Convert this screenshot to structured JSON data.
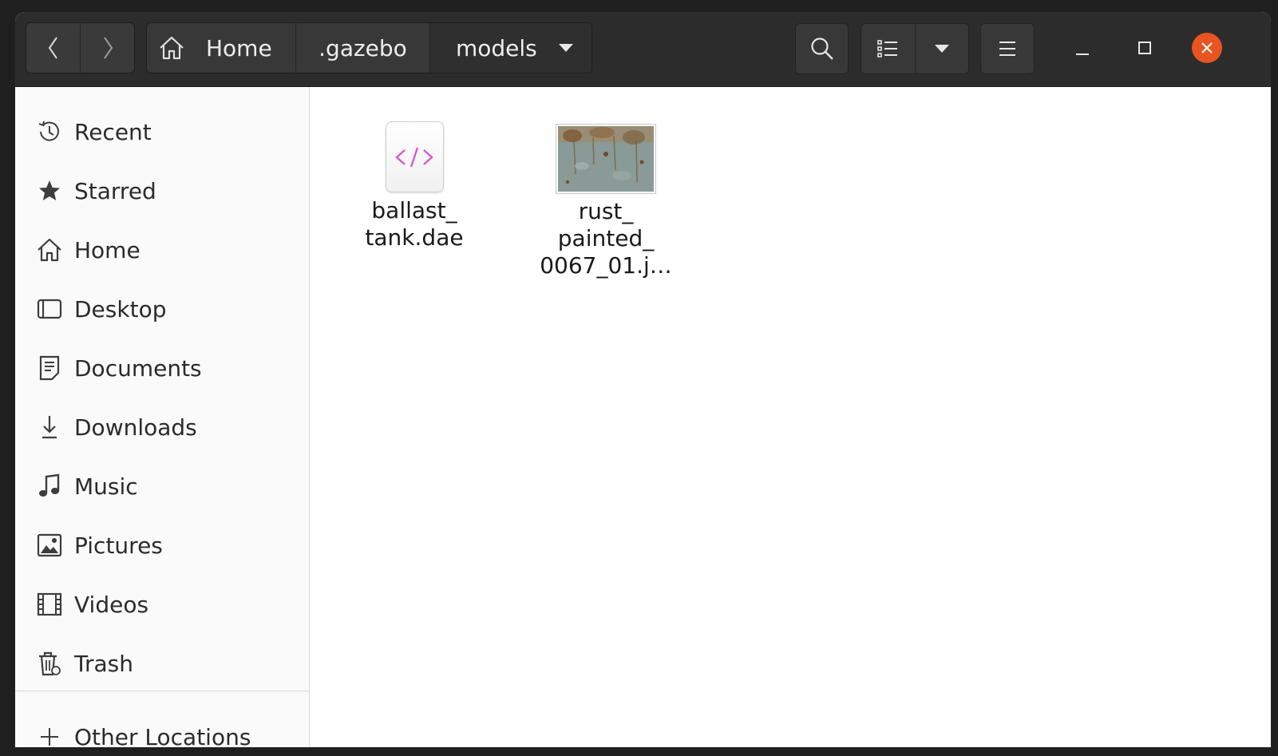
{
  "header": {
    "breadcrumbs": [
      "Home",
      ".gazebo",
      "models"
    ]
  },
  "sidebar": {
    "items": [
      {
        "label": "Recent",
        "icon": "recent-icon"
      },
      {
        "label": "Starred",
        "icon": "star-icon"
      },
      {
        "label": "Home",
        "icon": "home-icon"
      },
      {
        "label": "Desktop",
        "icon": "desktop-icon"
      },
      {
        "label": "Documents",
        "icon": "documents-icon"
      },
      {
        "label": "Downloads",
        "icon": "downloads-icon"
      },
      {
        "label": "Music",
        "icon": "music-icon"
      },
      {
        "label": "Pictures",
        "icon": "pictures-icon"
      },
      {
        "label": "Videos",
        "icon": "videos-icon"
      },
      {
        "label": "Trash",
        "icon": "trash-icon"
      }
    ],
    "other_locations": "Other Locations"
  },
  "files": [
    {
      "line1": "ballast_",
      "line2": "tank.dae",
      "line3": "",
      "icon": "code-file-icon"
    },
    {
      "line1": "rust_",
      "line2": "painted_",
      "line3": "0067_01.j…",
      "icon": "image-thumbnail"
    }
  ],
  "colors": {
    "header_bg": "#2c2c2c",
    "close_button": "#e95420",
    "code_icon_accent": "#d45ad4"
  }
}
